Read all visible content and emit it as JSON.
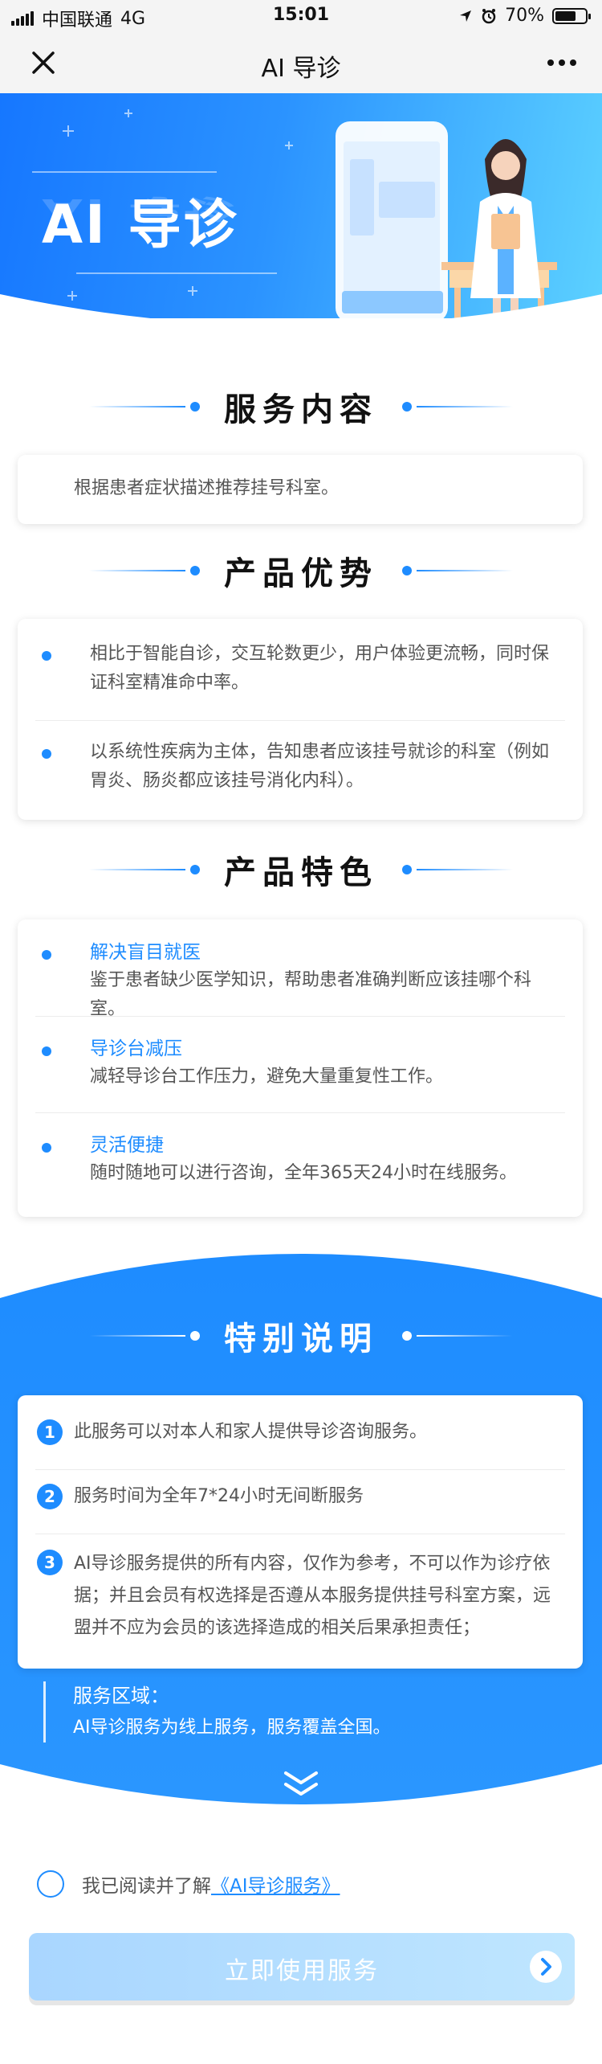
{
  "status_bar": {
    "carrier": "中国联通",
    "network": "4G",
    "time": "15:01",
    "battery": "70%",
    "battery_level": 0.7
  },
  "nav": {
    "title": "AI 导诊"
  },
  "hero": {
    "title": "AI 导诊"
  },
  "service": {
    "title": "服务内容",
    "text": "根据患者症状描述推荐挂号科室。"
  },
  "advantages": {
    "title": "产品优势",
    "items": [
      "相比于智能自诊，交互轮数更少，用户体验更流畅，同时保证科室精准命中率。",
      "以系统性疾病为主体，告知患者应该挂号就诊的科室（例如胃炎、肠炎都应该挂号消化内科）。"
    ]
  },
  "features": {
    "title": "产品特色",
    "items": [
      {
        "title": "解决盲目就医",
        "desc": "鉴于患者缺少医学知识，帮助患者准确判断应该挂哪个科室。"
      },
      {
        "title": "导诊台减压",
        "desc": "减轻导诊台工作压力，避免大量重复性工作。"
      },
      {
        "title": "灵活便捷",
        "desc": "随时随地可以进行咨询，全年365天24小时在线服务。"
      }
    ]
  },
  "special": {
    "title": "特别说明",
    "items": [
      {
        "num": "1",
        "text": "此服务可以对本人和家人提供导诊咨询服务。"
      },
      {
        "num": "2",
        "text": "服务时间为全年7*24小时无间断服务"
      },
      {
        "num": "3",
        "text": "AI导诊服务提供的所有内容，仅作为参考，不可以作为诊疗依据；并且会员有权选择是否遵从本服务提供挂号科室方案，远盟并不应为会员的该选择造成的相关后果承担责任；"
      }
    ],
    "region_label": "服务区域：",
    "region_text": "AI导诊服务为线上服务，服务覆盖全国。"
  },
  "agreement": {
    "prefix": "我已阅读并了解",
    "link": "《AI导诊服务》"
  },
  "cta": {
    "label": "立即使用服务"
  },
  "colors": {
    "accent": "#1e8cff",
    "hero_start": "#1677ff",
    "hero_end": "#5cd1ff",
    "cta_bg": "#b3dcff"
  }
}
